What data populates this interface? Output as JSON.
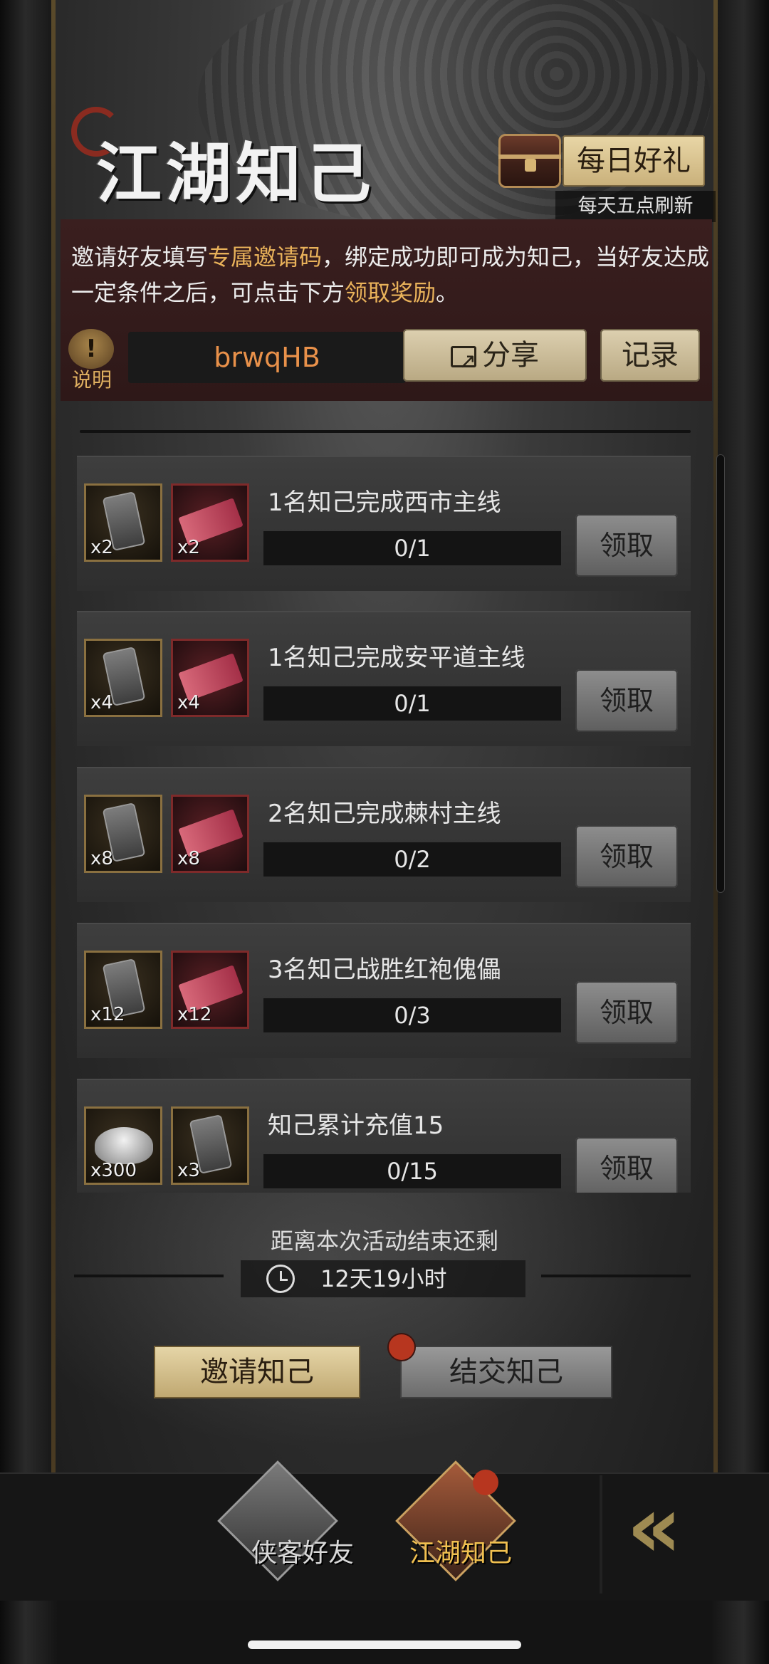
{
  "header": {
    "title": "江湖知己",
    "daily_gift_label": "每日好礼",
    "daily_refresh_note": "每天五点刷新"
  },
  "invite_description": {
    "part1": "邀请好友填写",
    "highlight1": "专属邀请码",
    "part2": "，绑定成功即可成为知己，当好友达成一定条件之后，可点击下方",
    "highlight2": "领取奖励",
    "part3": "。"
  },
  "info": {
    "icon": "exclamation-icon",
    "label": "说明"
  },
  "invite_code": "brwqHB",
  "share_label": "分享",
  "record_label": "记录",
  "tasks": [
    {
      "title": "1名知己完成西市主线",
      "progress": "0/1",
      "claim_label": "领取",
      "rewards": [
        {
          "icon": "token-tag-icon",
          "qty": "x2"
        },
        {
          "icon": "red-ticket-icon",
          "qty": "x2"
        }
      ]
    },
    {
      "title": "1名知己完成安平道主线",
      "progress": "0/1",
      "claim_label": "领取",
      "rewards": [
        {
          "icon": "token-tag-icon",
          "qty": "x4"
        },
        {
          "icon": "red-ticket-icon",
          "qty": "x4"
        }
      ]
    },
    {
      "title": "2名知己完成棘村主线",
      "progress": "0/2",
      "claim_label": "领取",
      "rewards": [
        {
          "icon": "token-tag-icon",
          "qty": "x8"
        },
        {
          "icon": "red-ticket-icon",
          "qty": "x8"
        }
      ]
    },
    {
      "title": "3名知己战胜红袍傀儡",
      "progress": "0/3",
      "claim_label": "领取",
      "rewards": [
        {
          "icon": "token-tag-icon",
          "qty": "x12"
        },
        {
          "icon": "red-ticket-icon",
          "qty": "x12"
        }
      ]
    },
    {
      "title": "知己累计充值15",
      "progress": "0/15",
      "claim_label": "领取",
      "rewards": [
        {
          "icon": "silver-ingot-icon",
          "qty": "x300"
        },
        {
          "icon": "token-tag-icon",
          "qty": "x3"
        }
      ]
    }
  ],
  "activity": {
    "ends_label": "距离本次活动结束还剩",
    "remaining": "12天19小时"
  },
  "actions": {
    "invite_label": "邀请知己",
    "befriend_label": "结交知己"
  },
  "bottom_nav": {
    "items": [
      {
        "label": "侠客好友",
        "icon": "hero-portrait-icon",
        "active": false
      },
      {
        "label": "江湖知己",
        "icon": "jianghu-emblem-icon",
        "active": true
      }
    ],
    "back_icon": "double-chevron-left-icon"
  },
  "colors": {
    "highlight": "#e9b25a",
    "invite_code": "#e9914a",
    "active_nav": "#f0c050",
    "notification_dot": "#b7361f"
  }
}
